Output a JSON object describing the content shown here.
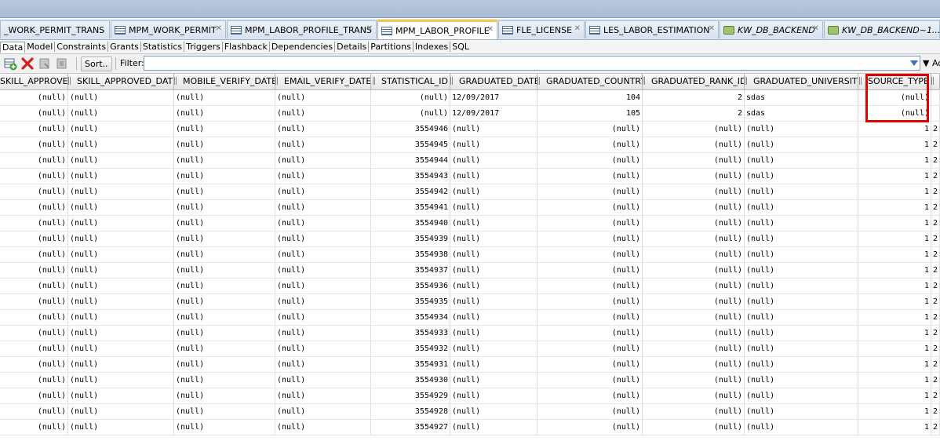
{
  "tabs": [
    {
      "label": "_WORK_PERMIT_TRANS",
      "icon": "table-icon",
      "active": false,
      "italic": false
    },
    {
      "label": "MPM_WORK_PERMIT",
      "icon": "table-icon",
      "active": false,
      "italic": false
    },
    {
      "label": "MPM_LABOR_PROFILE_TRANS",
      "icon": "table-icon",
      "active": false,
      "italic": false
    },
    {
      "label": "MPM_LABOR_PROFILE",
      "icon": "table-icon",
      "active": true,
      "italic": false
    },
    {
      "label": "FLE_LICENSE",
      "icon": "table-icon",
      "active": false,
      "italic": false
    },
    {
      "label": "LES_LABOR_ESTIMATION",
      "icon": "table-icon",
      "active": false,
      "italic": false
    },
    {
      "label": "KW_DB_BACKEND",
      "icon": "sql-worksheet-icon",
      "active": false,
      "italic": true
    },
    {
      "label": "KW_DB_BACKEND~1...",
      "icon": "sql-worksheet-icon",
      "active": false,
      "italic": true
    }
  ],
  "subtabs": [
    "Data",
    "Model",
    "Constraints",
    "Grants",
    "Statistics",
    "Triggers",
    "Flashback",
    "Dependencies",
    "Details",
    "Partitions",
    "Indexes",
    "SQL"
  ],
  "toolbar": {
    "sort_label": "Sort..",
    "filter_label": "Filter:",
    "filter_value": "",
    "actions_label": "Ac"
  },
  "grid": {
    "columns": [
      "SKILL_APPROVED",
      "SKILL_APPROVED_DATE",
      "MOBILE_VERIFY_DATE",
      "EMAIL_VERIFY_DATE",
      "STATISTICAL_ID",
      "GRADUATED_DATE",
      "GRADUATED_COUNTRY",
      "GRADUATED_RANK_ID",
      "GRADUATED_UNIVERSITY",
      "SOURCE_TYPE",
      ""
    ],
    "rows": [
      [
        "(null)",
        "(null)",
        "(null)",
        "(null)",
        "(null)",
        "12/09/2017",
        "104",
        "2",
        "sdas",
        "(null)",
        ""
      ],
      [
        "(null)",
        "(null)",
        "(null)",
        "(null)",
        "(null)",
        "12/09/2017",
        "105",
        "2",
        "sdas",
        "(null)",
        ""
      ],
      [
        "(null)",
        "(null)",
        "(null)",
        "(null)",
        "3554946",
        "(null)",
        "(null)",
        "(null)",
        "(null)",
        "1",
        "2"
      ],
      [
        "(null)",
        "(null)",
        "(null)",
        "(null)",
        "3554945",
        "(null)",
        "(null)",
        "(null)",
        "(null)",
        "1",
        "2"
      ],
      [
        "(null)",
        "(null)",
        "(null)",
        "(null)",
        "3554944",
        "(null)",
        "(null)",
        "(null)",
        "(null)",
        "1",
        "2"
      ],
      [
        "(null)",
        "(null)",
        "(null)",
        "(null)",
        "3554943",
        "(null)",
        "(null)",
        "(null)",
        "(null)",
        "1",
        "2"
      ],
      [
        "(null)",
        "(null)",
        "(null)",
        "(null)",
        "3554942",
        "(null)",
        "(null)",
        "(null)",
        "(null)",
        "1",
        "2"
      ],
      [
        "(null)",
        "(null)",
        "(null)",
        "(null)",
        "3554941",
        "(null)",
        "(null)",
        "(null)",
        "(null)",
        "1",
        "2"
      ],
      [
        "(null)",
        "(null)",
        "(null)",
        "(null)",
        "3554940",
        "(null)",
        "(null)",
        "(null)",
        "(null)",
        "1",
        "2"
      ],
      [
        "(null)",
        "(null)",
        "(null)",
        "(null)",
        "3554939",
        "(null)",
        "(null)",
        "(null)",
        "(null)",
        "1",
        "2"
      ],
      [
        "(null)",
        "(null)",
        "(null)",
        "(null)",
        "3554938",
        "(null)",
        "(null)",
        "(null)",
        "(null)",
        "1",
        "2"
      ],
      [
        "(null)",
        "(null)",
        "(null)",
        "(null)",
        "3554937",
        "(null)",
        "(null)",
        "(null)",
        "(null)",
        "1",
        "2"
      ],
      [
        "(null)",
        "(null)",
        "(null)",
        "(null)",
        "3554936",
        "(null)",
        "(null)",
        "(null)",
        "(null)",
        "1",
        "2"
      ],
      [
        "(null)",
        "(null)",
        "(null)",
        "(null)",
        "3554935",
        "(null)",
        "(null)",
        "(null)",
        "(null)",
        "1",
        "2"
      ],
      [
        "(null)",
        "(null)",
        "(null)",
        "(null)",
        "3554934",
        "(null)",
        "(null)",
        "(null)",
        "(null)",
        "1",
        "2"
      ],
      [
        "(null)",
        "(null)",
        "(null)",
        "(null)",
        "3554933",
        "(null)",
        "(null)",
        "(null)",
        "(null)",
        "1",
        "2"
      ],
      [
        "(null)",
        "(null)",
        "(null)",
        "(null)",
        "3554932",
        "(null)",
        "(null)",
        "(null)",
        "(null)",
        "1",
        "2"
      ],
      [
        "(null)",
        "(null)",
        "(null)",
        "(null)",
        "3554931",
        "(null)",
        "(null)",
        "(null)",
        "(null)",
        "1",
        "2"
      ],
      [
        "(null)",
        "(null)",
        "(null)",
        "(null)",
        "3554930",
        "(null)",
        "(null)",
        "(null)",
        "(null)",
        "1",
        "2"
      ],
      [
        "(null)",
        "(null)",
        "(null)",
        "(null)",
        "3554929",
        "(null)",
        "(null)",
        "(null)",
        "(null)",
        "1",
        "2"
      ],
      [
        "(null)",
        "(null)",
        "(null)",
        "(null)",
        "3554928",
        "(null)",
        "(null)",
        "(null)",
        "(null)",
        "1",
        "2"
      ],
      [
        "(null)",
        "(null)",
        "(null)",
        "(null)",
        "3554927",
        "(null)",
        "(null)",
        "(null)",
        "(null)",
        "1",
        "2"
      ]
    ],
    "highlighted_column": "SOURCE_TYPE",
    "highlight_color": "#e00000"
  }
}
